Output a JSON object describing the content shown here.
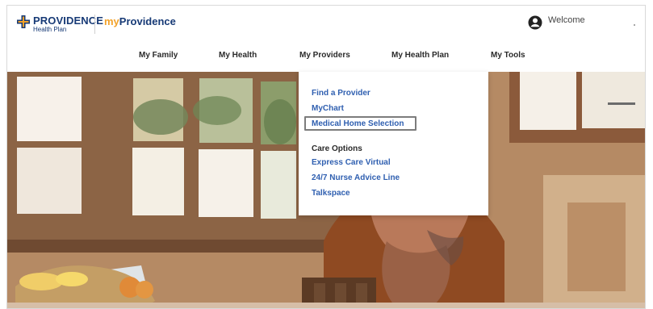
{
  "header": {
    "logo_title": "PROVIDENCE",
    "logo_subtitle": "Health Plan",
    "brand_my": "my",
    "brand_name": "Providence",
    "welcome": "Welcome",
    "user_icon": "user-circle-icon"
  },
  "nav": {
    "items": [
      {
        "label": "My Family"
      },
      {
        "label": "My Health"
      },
      {
        "label": "My Providers"
      },
      {
        "label": "My Health Plan"
      },
      {
        "label": "My Tools"
      }
    ]
  },
  "dropdown": {
    "items": [
      {
        "label": "Find a Provider"
      },
      {
        "label": "MyChart"
      },
      {
        "label": "Medical Home Selection"
      },
      {
        "label": "Care Options"
      },
      {
        "label": "Express Care Virtual"
      },
      {
        "label": "24/7 Nurse Advice Line"
      },
      {
        "label": "Talkspace"
      }
    ]
  },
  "colors": {
    "brand_blue": "#173a76",
    "brand_orange": "#f2a22a",
    "link_blue": "#2f5fb0",
    "highlight_border": "#7c7c7c"
  }
}
